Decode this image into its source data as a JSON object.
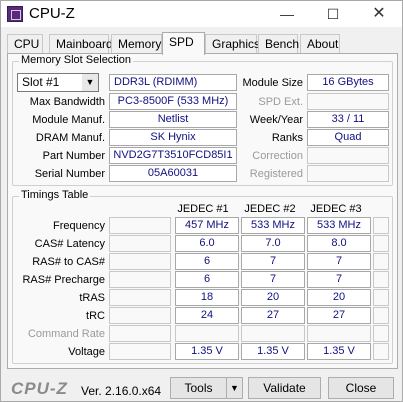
{
  "window": {
    "title": "CPU-Z",
    "min_glyph": "—",
    "max_glyph": "☐",
    "close_glyph": "✕"
  },
  "tabs": [
    "CPU",
    "Mainboard",
    "Memory",
    "SPD",
    "Graphics",
    "Bench",
    "About"
  ],
  "active_tab": "SPD",
  "slot_group": {
    "title": "Memory Slot Selection",
    "slot_selected": "Slot #1",
    "type": "DDR3L (RDIMM)",
    "module_size_label": "Module Size",
    "module_size": "16 GBytes",
    "max_bandwidth_label": "Max Bandwidth",
    "max_bandwidth": "PC3-8500F (533 MHz)",
    "spd_ext_label": "SPD Ext.",
    "spd_ext": "",
    "module_manuf_label": "Module Manuf.",
    "module_manuf": "Netlist",
    "week_year_label": "Week/Year",
    "week_year": "33 / 11",
    "dram_manuf_label": "DRAM Manuf.",
    "dram_manuf": "SK Hynix",
    "ranks_label": "Ranks",
    "ranks": "Quad",
    "part_number_label": "Part Number",
    "part_number": "NVD2G7T3510FCD85I1",
    "correction_label": "Correction",
    "correction": "",
    "serial_number_label": "Serial Number",
    "serial_number": "05A60031",
    "registered_label": "Registered",
    "registered": ""
  },
  "timings": {
    "title": "Timings Table",
    "columns": [
      "JEDEC #1",
      "JEDEC #2",
      "JEDEC #3"
    ],
    "rows": [
      {
        "label": "Frequency",
        "values": [
          "457 MHz",
          "533 MHz",
          "533 MHz"
        ],
        "gray": false
      },
      {
        "label": "CAS# Latency",
        "values": [
          "6.0",
          "7.0",
          "8.0"
        ],
        "gray": false
      },
      {
        "label": "RAS# to CAS#",
        "values": [
          "6",
          "7",
          "7"
        ],
        "gray": false
      },
      {
        "label": "RAS# Precharge",
        "values": [
          "6",
          "7",
          "7"
        ],
        "gray": false
      },
      {
        "label": "tRAS",
        "values": [
          "18",
          "20",
          "20"
        ],
        "gray": false
      },
      {
        "label": "tRC",
        "values": [
          "24",
          "27",
          "27"
        ],
        "gray": false
      },
      {
        "label": "Command Rate",
        "values": [
          "",
          "",
          ""
        ],
        "gray": true
      },
      {
        "label": "Voltage",
        "values": [
          "1.35 V",
          "1.35 V",
          "1.35 V"
        ],
        "gray": false
      }
    ]
  },
  "footer": {
    "logo": "CPU-Z",
    "version": "Ver. 2.16.0.x64",
    "tools_label": "Tools",
    "tools_arrow": "▼",
    "validate_label": "Validate",
    "close_label": "Close"
  }
}
